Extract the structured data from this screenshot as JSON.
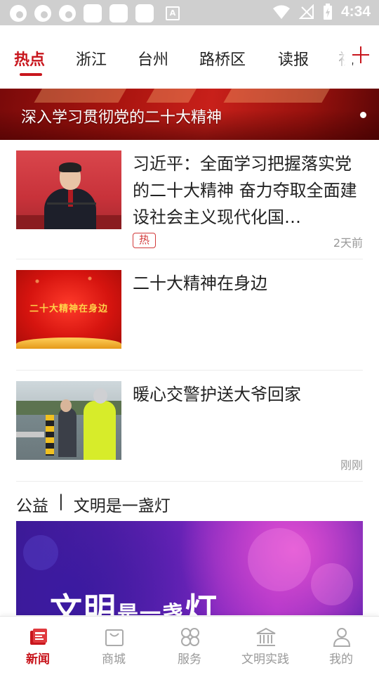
{
  "status_bar": {
    "time": "4:34"
  },
  "channels": [
    {
      "label": "热点",
      "active": true
    },
    {
      "label": "浙江"
    },
    {
      "label": "台州"
    },
    {
      "label": "路桥区"
    },
    {
      "label": "读报"
    },
    {
      "label": "视"
    }
  ],
  "banner": {
    "title": "深入学习贯彻党的二十大精神"
  },
  "news": [
    {
      "title": "习近平：全面学习把握落实党的二十大精神 奋力夺取全面建设社会主义现代化国…",
      "badge": "热",
      "time": "2天前"
    },
    {
      "title": "二十大精神在身边",
      "thumb_caption": "二十大精神在身边"
    },
    {
      "title": "暖心交警护送大爷回家",
      "time": "刚刚"
    }
  ],
  "section": {
    "left": "公益",
    "separator": "|",
    "right": "文明是一盏灯"
  },
  "promo": {
    "text_big_1": "文明",
    "text_small": "是一盏",
    "text_big_2": "灯"
  },
  "bottom_nav": [
    {
      "label": "新闻",
      "icon": "news-icon",
      "active": true
    },
    {
      "label": "商城",
      "icon": "shopping-bag-icon"
    },
    {
      "label": "服务",
      "icon": "services-icon"
    },
    {
      "label": "文明实践",
      "icon": "civic-building-icon"
    },
    {
      "label": "我的",
      "icon": "user-icon"
    }
  ],
  "colors": {
    "accent": "#c8161d",
    "status_bar": "#cfcfcf",
    "muted_text": "#999999"
  }
}
